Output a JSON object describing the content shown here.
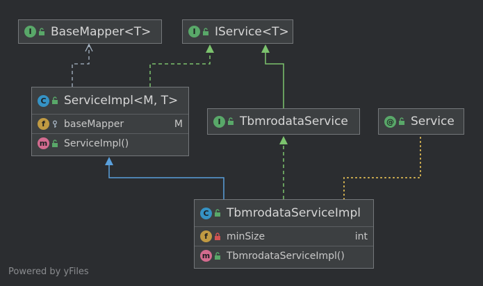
{
  "diagram": {
    "nodes": {
      "base_mapper": {
        "kind": "I",
        "title": "BaseMapper<T>"
      },
      "iservice": {
        "kind": "I",
        "title": "IService<T>"
      },
      "service_impl": {
        "kind": "C",
        "title": "ServiceImpl<M, T>",
        "fields": [
          {
            "kind": "f",
            "name": "baseMapper",
            "type": "M"
          }
        ],
        "methods": [
          {
            "kind": "m",
            "name": "ServiceImpl()"
          }
        ]
      },
      "tbmroda_service": {
        "kind": "I",
        "title": "TbmrodataService"
      },
      "service_annotation": {
        "kind": "@",
        "title": "Service"
      },
      "tbmroda_service_impl": {
        "kind": "C",
        "title": "TbmrodataServiceImpl",
        "fields": [
          {
            "kind": "f",
            "name": "minSize",
            "type": "int"
          }
        ],
        "methods": [
          {
            "kind": "m",
            "name": "TbmrodataServiceImpl()"
          }
        ]
      }
    },
    "colors": {
      "realization": "#7cc36e",
      "inheritance": "#5aa0dc",
      "dependency": "#a9b7c6",
      "annotation": "#d9b652"
    }
  },
  "footer": {
    "text": "Powered by yFiles"
  }
}
